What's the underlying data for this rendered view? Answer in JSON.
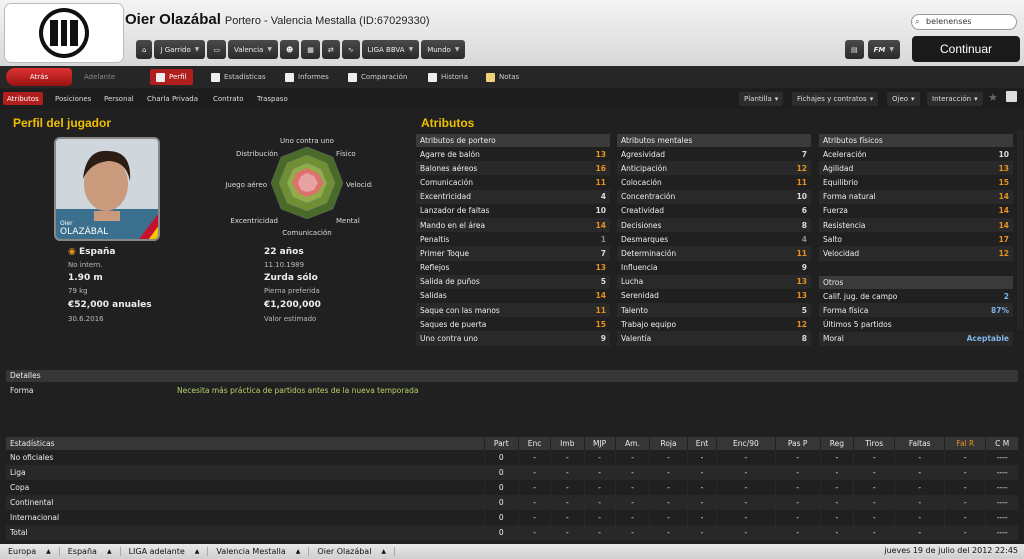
{
  "header": {
    "name": "Oier Olazábal",
    "subtitle": "Portero - Valencia Mestalla (ID:67029330)",
    "search": "belenenses",
    "continue": "Continuar"
  },
  "nav": {
    "items": [
      "J Garrido",
      "Valencia",
      "LIGA BBVA",
      "Mundo"
    ],
    "fm": "FM"
  },
  "tabs": {
    "back": "Atrás",
    "forward": "Adelante",
    "items": [
      "Perfil",
      "Estadísticas",
      "Informes",
      "Comparación",
      "Historia",
      "Notas"
    ]
  },
  "subtabs": [
    "Atributos",
    "Posiciones",
    "Personal",
    "Charla Privada",
    "Contrato",
    "Traspaso"
  ],
  "dropdowns": [
    "Plantilla",
    "Fichajes y contratos",
    "Ojeo",
    "Interacción"
  ],
  "profile": {
    "title": "Perfil del jugador",
    "photo_first": "Oier",
    "photo_last": "OLAZÁBAL",
    "nation": "España",
    "nation_sub": "No intern.",
    "height": "1.90 m",
    "weight": "79 kg",
    "wage": "€52,000 anuales",
    "contract": "30.6.2016",
    "age": "22 años",
    "dob": "11.10.1989",
    "foot": "Zurda sólo",
    "foot_label": "Pierna preferida",
    "value": "€1,200,000",
    "value_label": "Valor estimado"
  },
  "radar_labels": [
    "Uno contra uno",
    "Físico",
    "Velocidad",
    "Mental",
    "Comunicación",
    "Excentricidad",
    "Juego aéreo",
    "Distribución"
  ],
  "attributes": {
    "title": "Atributos",
    "goalkeeper": {
      "title": "Atributos de portero",
      "rows": [
        [
          "Agarre de balón",
          "13",
          "o"
        ],
        [
          "Balones aéreos",
          "16",
          "o"
        ],
        [
          "Comunicación",
          "11",
          "o"
        ],
        [
          "Excentricidad",
          "4",
          ""
        ],
        [
          "Lanzador de faltas",
          "10",
          ""
        ],
        [
          "Mando en el área",
          "14",
          "o"
        ],
        [
          "Penaltis",
          "1",
          "g"
        ],
        [
          "Primer Toque",
          "7",
          ""
        ],
        [
          "Reflejos",
          "13",
          "o"
        ],
        [
          "Salida de puños",
          "5",
          ""
        ],
        [
          "Salidas",
          "14",
          "o"
        ],
        [
          "Saque con las manos",
          "11",
          "o"
        ],
        [
          "Saques de puerta",
          "15",
          "o"
        ],
        [
          "Uno contra uno",
          "9",
          ""
        ]
      ]
    },
    "mental": {
      "title": "Atributos mentales",
      "rows": [
        [
          "Agresividad",
          "7",
          ""
        ],
        [
          "Anticipación",
          "12",
          "o"
        ],
        [
          "Colocación",
          "11",
          "o"
        ],
        [
          "Concentración",
          "10",
          ""
        ],
        [
          "Creatividad",
          "6",
          ""
        ],
        [
          "Decisiones",
          "8",
          ""
        ],
        [
          "Desmarques",
          "4",
          "g"
        ],
        [
          "Determinación",
          "11",
          "o"
        ],
        [
          "Influencia",
          "9",
          ""
        ],
        [
          "Lucha",
          "13",
          "o"
        ],
        [
          "Serenidad",
          "13",
          "o"
        ],
        [
          "Talento",
          "5",
          ""
        ],
        [
          "Trabajo equipo",
          "12",
          "o"
        ],
        [
          "Valentía",
          "8",
          ""
        ]
      ]
    },
    "physical": {
      "title": "Atributos físicos",
      "rows": [
        [
          "Aceleración",
          "10",
          ""
        ],
        [
          "Agilidad",
          "13",
          "o"
        ],
        [
          "Equilibrio",
          "15",
          "o"
        ],
        [
          "Forma natural",
          "14",
          "o"
        ],
        [
          "Fuerza",
          "14",
          "o"
        ],
        [
          "Resistencia",
          "14",
          "o"
        ],
        [
          "Salto",
          "17",
          "o"
        ],
        [
          "Velocidad",
          "12",
          "o"
        ]
      ]
    },
    "other": {
      "title": "Otros",
      "rows": [
        [
          "Calif. jug. de campo",
          "2",
          "bl"
        ],
        [
          "Forma física",
          "87%",
          "bl"
        ],
        [
          "Últimos 5 partidos",
          "",
          ""
        ],
        [
          "Moral",
          "Aceptable",
          "bl"
        ]
      ]
    }
  },
  "details": {
    "title": "Detalles",
    "label": "Forma",
    "text": "Necesita más práctica de partidos antes de la nueva temporada"
  },
  "stats": {
    "headers": [
      "Estadísticas",
      "Part",
      "Enc",
      "Imb",
      "MJP",
      "Am.",
      "Roja",
      "Ent",
      "Enc/90",
      "Pas P",
      "Reg",
      "Tiros",
      "Faltas",
      "Fal R",
      "C M"
    ],
    "rows": [
      [
        "No oficiales",
        "0",
        "-",
        "-",
        "-",
        "-",
        "-",
        "-",
        "-",
        "-",
        "-",
        "-",
        "-",
        "-",
        "----"
      ],
      [
        "Liga",
        "0",
        "-",
        "-",
        "-",
        "-",
        "-",
        "-",
        "-",
        "-",
        "-",
        "-",
        "-",
        "-",
        "----"
      ],
      [
        "Copa",
        "0",
        "-",
        "-",
        "-",
        "-",
        "-",
        "-",
        "-",
        "-",
        "-",
        "-",
        "-",
        "-",
        "----"
      ],
      [
        "Continental",
        "0",
        "-",
        "-",
        "-",
        "-",
        "-",
        "-",
        "-",
        "-",
        "-",
        "-",
        "-",
        "-",
        "----"
      ],
      [
        "Internacional",
        "0",
        "-",
        "-",
        "-",
        "-",
        "-",
        "-",
        "-",
        "-",
        "-",
        "-",
        "-",
        "-",
        "----"
      ],
      [
        "Total",
        "0",
        "-",
        "-",
        "-",
        "-",
        "-",
        "-",
        "-",
        "-",
        "-",
        "-",
        "-",
        "-",
        "----"
      ]
    ]
  },
  "statusbar": {
    "crumbs": [
      "Europa",
      "España",
      "LIGA adelante",
      "Valencia Mestalla",
      "Oier Olazábal"
    ],
    "clock": "jueves 19 de julio del 2012 22:45"
  },
  "colors": {
    "accent": "#f0c000",
    "highlight": "#e8921e",
    "active_tab": "#b01e1e"
  }
}
